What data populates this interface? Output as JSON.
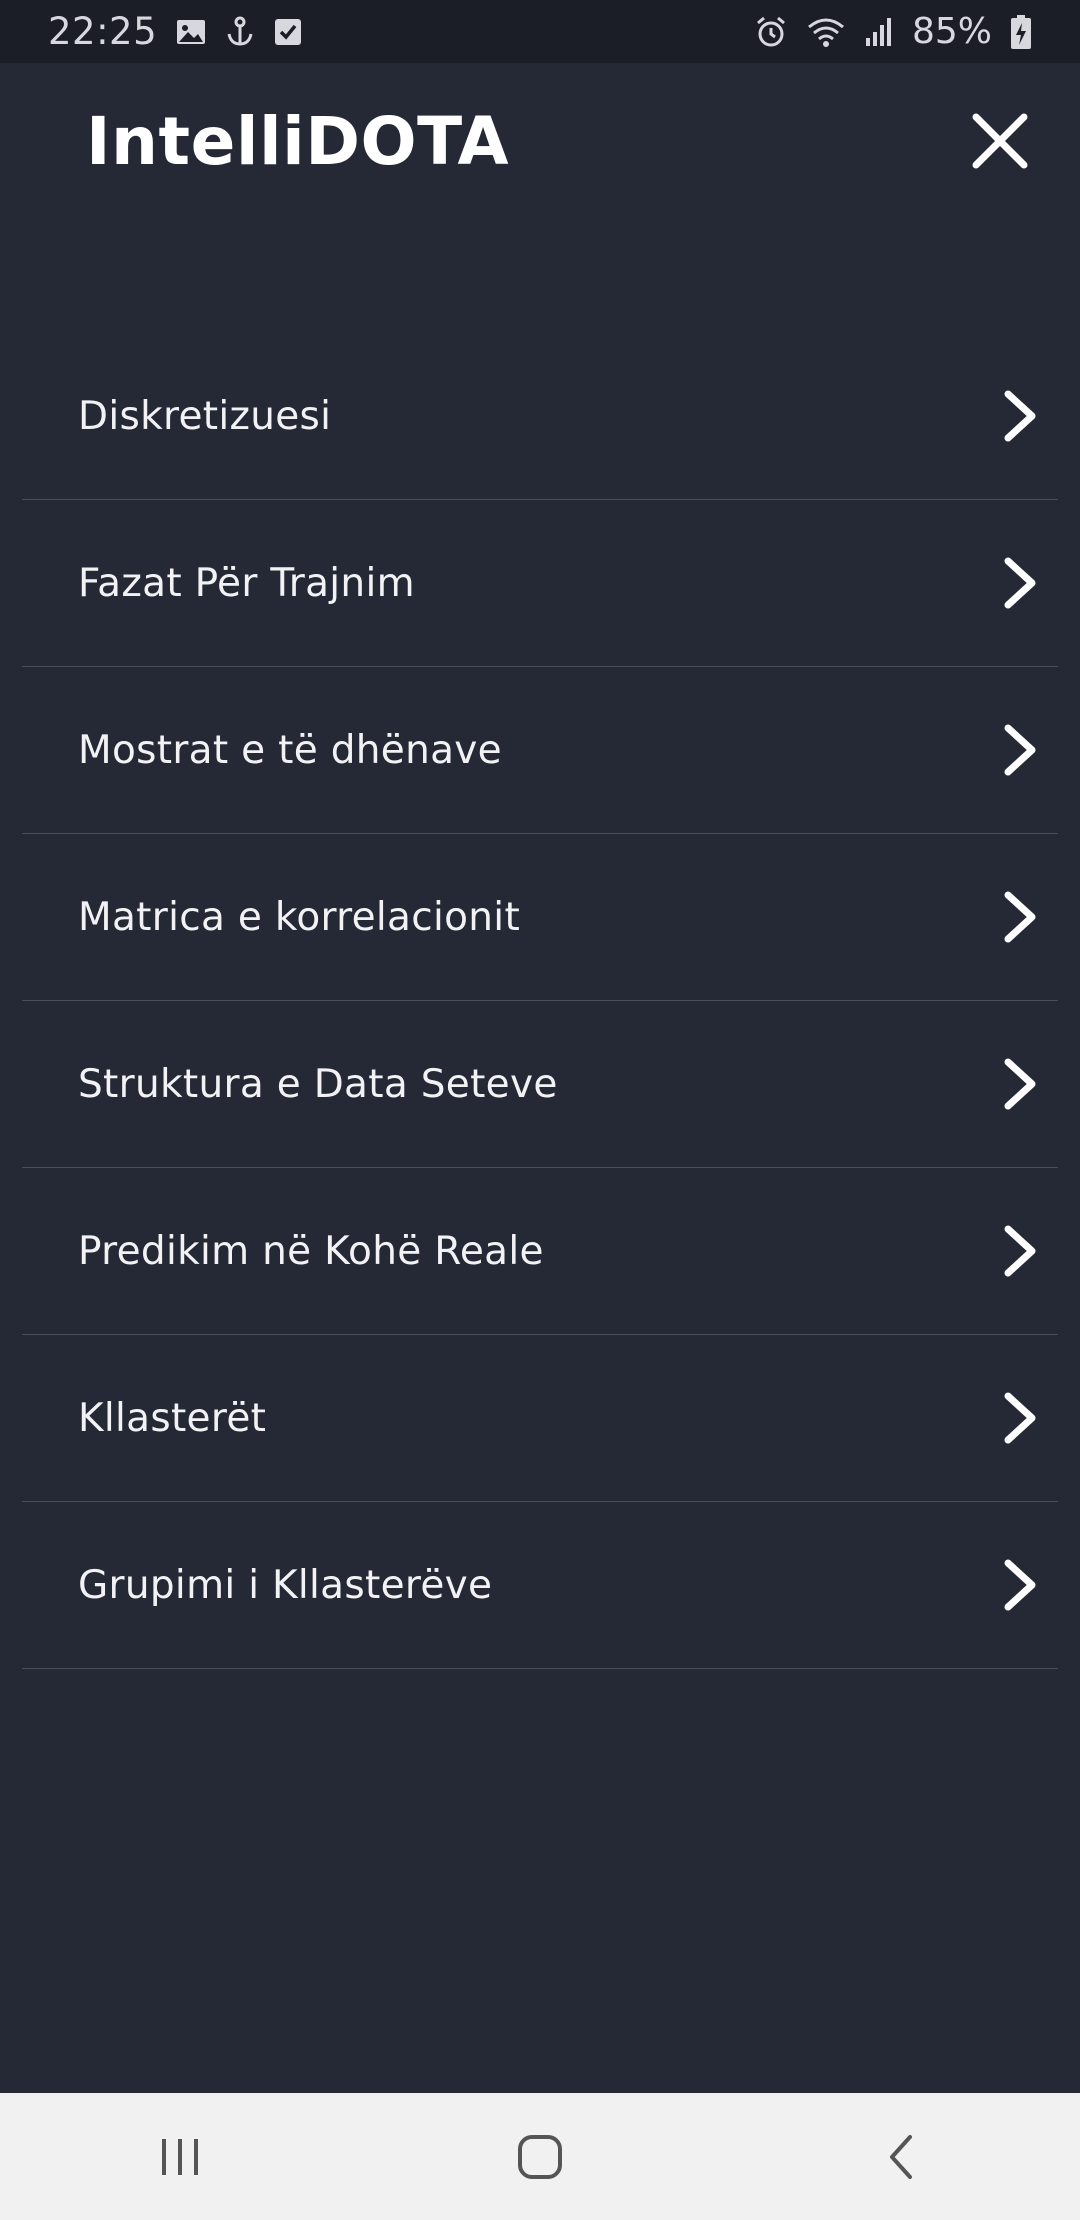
{
  "status_bar": {
    "time": "22:25",
    "left_icons": [
      "image-icon",
      "anchor-notification-icon",
      "checkbox-icon"
    ],
    "right_icons": [
      "alarm-icon",
      "wifi-icon",
      "signal-icon",
      "battery-charging-icon"
    ],
    "battery_percent": "85%"
  },
  "header": {
    "title": "IntelliDOTA",
    "close_icon": "close-icon"
  },
  "menu": {
    "items": [
      {
        "label": "Diskretizuesi"
      },
      {
        "label": "Fazat Për Trajnim"
      },
      {
        "label": "Mostrat e të dhënave"
      },
      {
        "label": "Matrica e korrelacionit"
      },
      {
        "label": "Struktura e Data Seteve"
      },
      {
        "label": "Predikim në Kohë Reale"
      },
      {
        "label": "Kllasterët"
      },
      {
        "label": "Grupimi i Kllasterëve"
      }
    ]
  },
  "nav_bar": {
    "buttons": [
      "recents-icon",
      "home-icon",
      "back-icon"
    ]
  },
  "colors": {
    "background": "#252835",
    "status_bar": "#1b1d27",
    "divider": "#4a4d5a",
    "text": "#ffffff",
    "nav_bar": "#f1f1f1"
  }
}
